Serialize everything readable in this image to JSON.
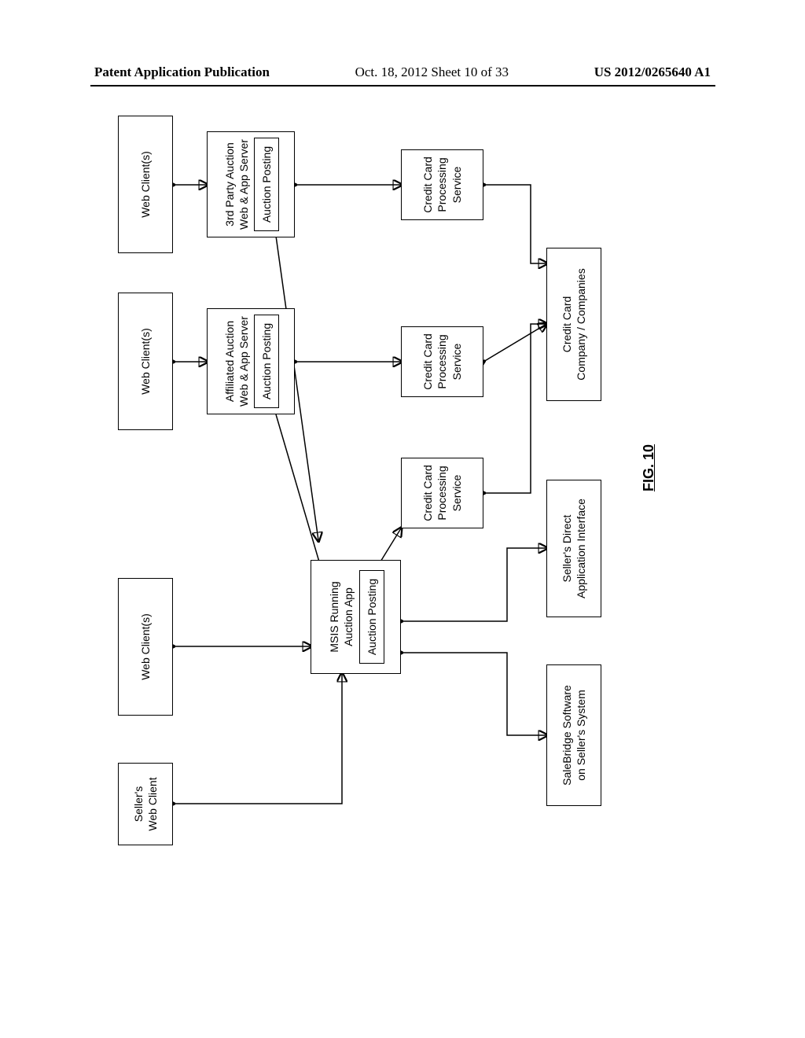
{
  "header": {
    "left": "Patent Application Publication",
    "center": "Oct. 18, 2012  Sheet 10 of 33",
    "right": "US 2012/0265640 A1"
  },
  "figure_label": "FIG. 10",
  "boxes": {
    "sellers_web_client": "Seller's\nWeb Client",
    "web_client_1": "Web Client(s)",
    "web_client_2": "Web Client(s)",
    "web_client_3": "Web Client(s)",
    "msis_title": "MSIS Running\nAuction App",
    "msis_inner": "Auction Posting",
    "affiliated_title": "Affiliated Auction\nWeb & App Server",
    "affiliated_inner": "Auction  Posting",
    "thirdparty_title": "3rd Party Auction\nWeb & App Server",
    "thirdparty_inner": "Auction Posting",
    "cc_service_1": "Credit Card\nProcessing\nService",
    "cc_service_2": "Credit Card\nProcessing\nService",
    "cc_service_3": "Credit Card\nProcessing\nService",
    "salebridge": "SaleBridge Software\non Seller's System",
    "sellers_direct": "Seller's Direct\nApplication Interface",
    "cc_companies": "Credit Card\nCompany / Companies"
  }
}
